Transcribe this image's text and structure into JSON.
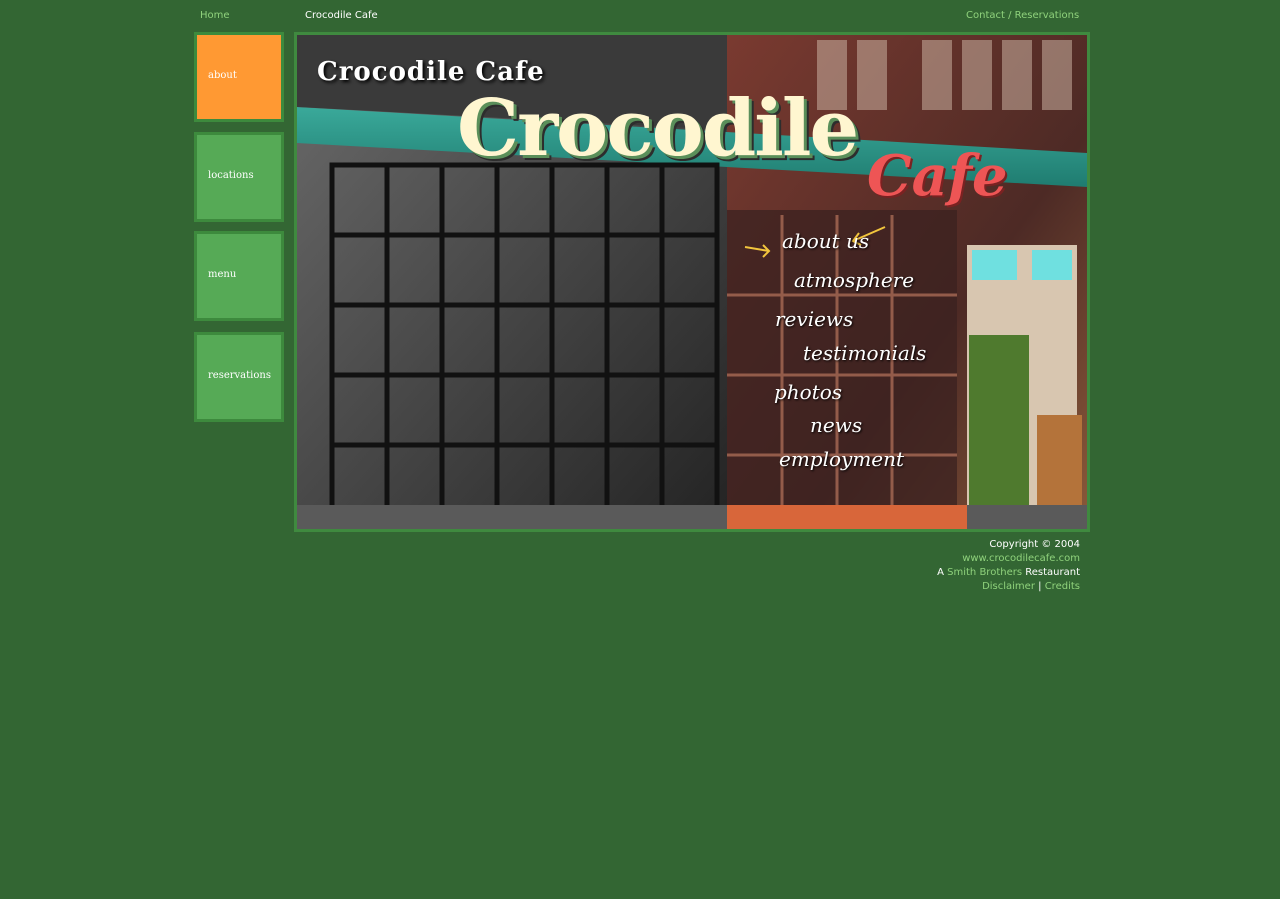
{
  "header": {
    "home_label": "Home",
    "site_title": "Crocodile Cafe",
    "contact_label": "Contact / Reservations"
  },
  "nav": {
    "items": [
      {
        "label": "about",
        "active": true
      },
      {
        "label": "locations",
        "active": false
      },
      {
        "label": "menu",
        "active": false
      },
      {
        "label": "reservations",
        "active": false
      }
    ]
  },
  "hero": {
    "title": "Crocodile Cafe",
    "sign_text": "Crocodile",
    "sign_subtext": "Cafe",
    "script_links": [
      "about us",
      "atmosphere",
      "reviews",
      "testimonials",
      "photos",
      "news",
      "employment"
    ]
  },
  "footer": {
    "copyright": "Copyright © 2004",
    "website": "www.crocodilecafe.com",
    "restaurant_prefix": "A",
    "restaurant_link": "Smith Brothers",
    "restaurant_suffix": "Restaurant",
    "disclaimer_label": "Disclaimer",
    "separator": "|",
    "credits_label": "Credits"
  },
  "colors": {
    "background": "#336633",
    "nav_default": "#56aa56",
    "nav_active": "#ff9933",
    "link_green": "#8fd27c",
    "awning_teal": "#2e9a8c"
  }
}
